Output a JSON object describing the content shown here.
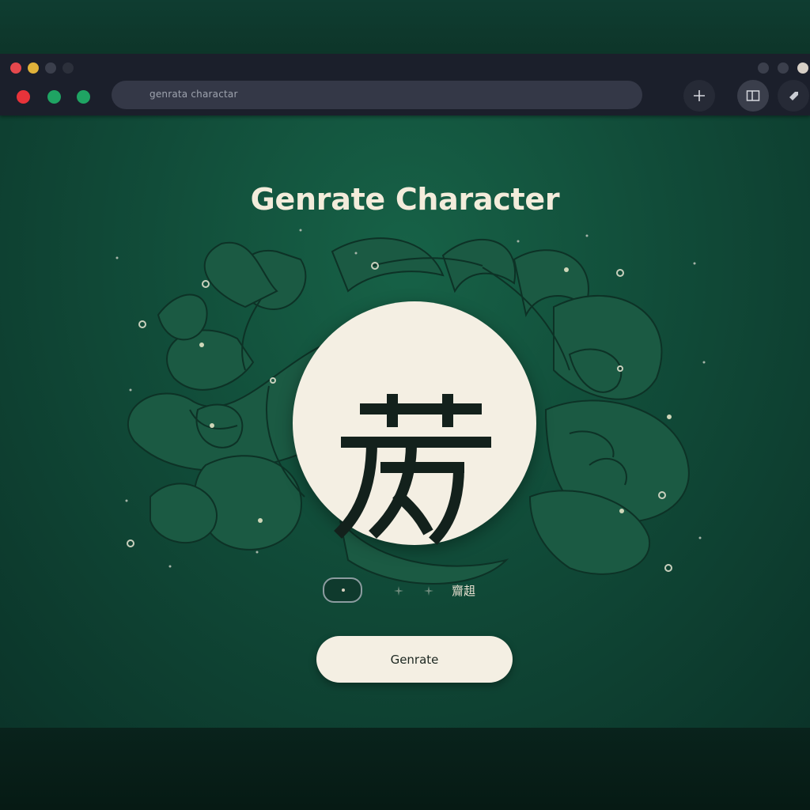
{
  "browser": {
    "address_text": "genrata charactar",
    "traffic_lights_top": [
      "#e5484d",
      "#e0b23a",
      "#3b3f4c",
      "#2c303b"
    ],
    "traffic_lights_main": [
      "#e8333a",
      "#1fa463",
      "#1fa463"
    ],
    "right_dots": [
      "#3b3f4c",
      "#3b3f4c",
      "#d7cfc6"
    ],
    "icons": {
      "new_tab": "plus-icon",
      "sidebar": "sidebar-panel-icon",
      "extension": "tag-icon"
    }
  },
  "main": {
    "title": "Genrate Character",
    "character_glyph": "character-glyph",
    "caption": "齎趄",
    "button_label": "Genrate"
  },
  "colors": {
    "background": "#114c39",
    "cream": "#f4efe3",
    "ink": "#13211c",
    "toolbar": "#1b1f2b"
  }
}
